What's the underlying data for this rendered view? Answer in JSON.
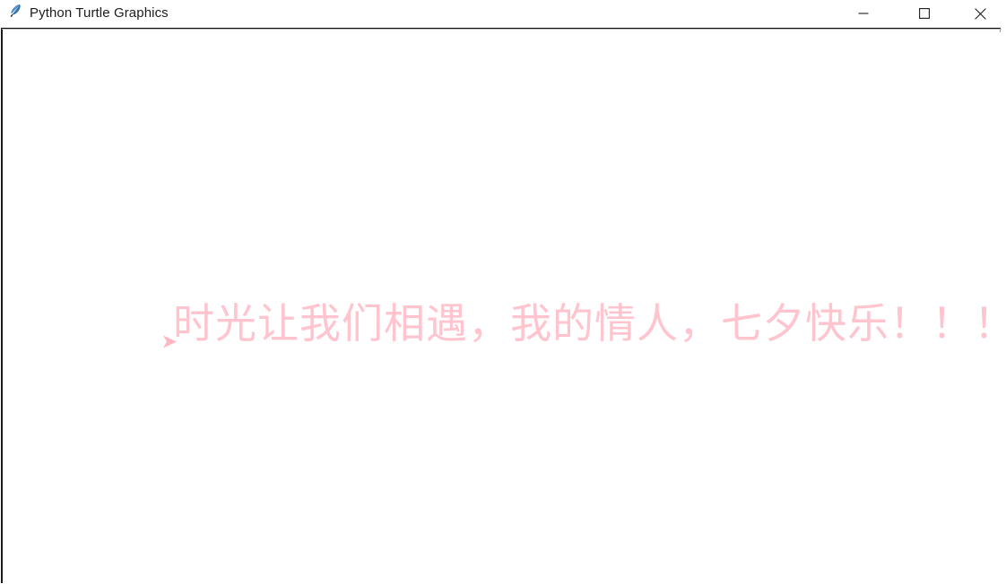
{
  "window": {
    "title": "Python Turtle Graphics",
    "icon": "python-feather-icon",
    "background_color": "#ffffff",
    "controls": [
      {
        "name": "minimize",
        "glyph": "—",
        "label": "Minimize"
      },
      {
        "name": "maximize",
        "glyph": "□",
        "label": "Maximize"
      },
      {
        "name": "close",
        "glyph": "✕",
        "label": "Close"
      }
    ]
  },
  "canvas": {
    "background_color": "#ffffff",
    "border_color": "#0b0b0b",
    "drawn_text": "时光让我们相遇，我的情人，七夕快乐！！！",
    "text_color": "#ffc4ce",
    "turtle": {
      "shape": "arrow-triangle",
      "color": "#ffb6c1",
      "heading_degrees": 0
    }
  }
}
